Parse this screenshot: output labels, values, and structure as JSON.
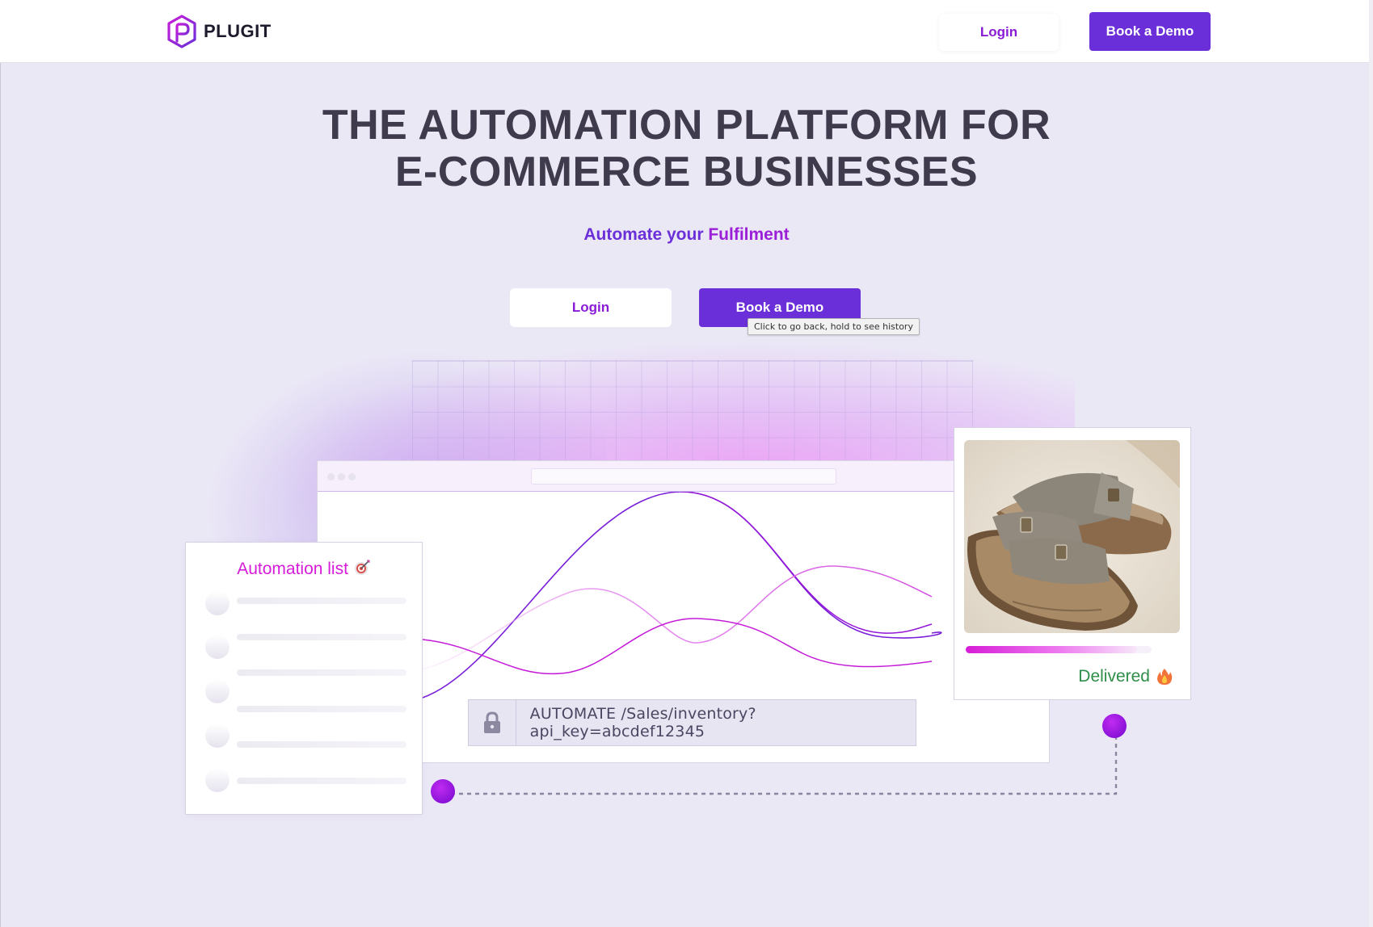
{
  "nav": {
    "logo_text": "PLUGIT",
    "login_label": "Login",
    "demo_label": "Book a Demo"
  },
  "hero": {
    "title_line1": "THE AUTOMATION PLATFORM FOR",
    "title_line2": "E-COMMERCE BUSINESSES",
    "subtitle_prefix": "Automate your ",
    "subtitle_highlight": "Fulfilment",
    "login_label": "Login",
    "demo_label": "Book a Demo"
  },
  "tooltip": {
    "text": "Click to go back, hold to see history"
  },
  "automation_card": {
    "title": "Automation list",
    "title_icon": "target-icon",
    "placeholder_rows": 5
  },
  "api_bar": {
    "icon": "lock-icon",
    "text": "AUTOMATE /Sales/inventory?api_key=abcdef12345"
  },
  "product_card": {
    "image": "sandals-photo",
    "progress_fraction": 0.92,
    "status_text": "Delivered",
    "status_icon": "fire-icon"
  },
  "colors": {
    "primary": "#6a2fd8",
    "accent": "#9c1fd8",
    "magenta": "#d51cd8",
    "success": "#2f8e49",
    "title": "#3f3b4d",
    "background": "#ebe8f6"
  }
}
